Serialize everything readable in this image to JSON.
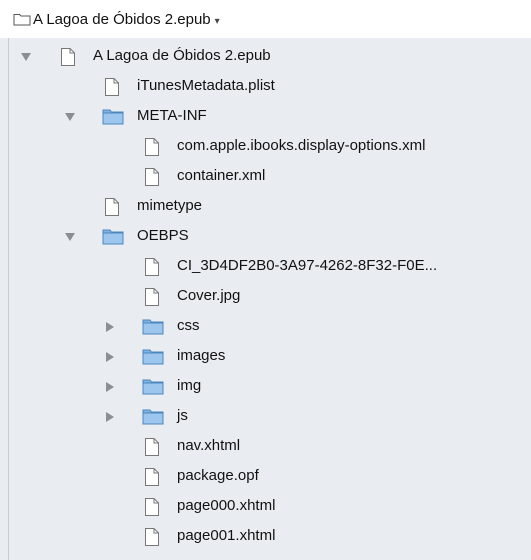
{
  "header": {
    "title": "A Lagoa de Óbidos 2.epub",
    "caret": "▾",
    "icon": "folder-outline-icon"
  },
  "tree": {
    "items": [
      {
        "label": "A Lagoa de Óbidos 2.epub",
        "type": "file",
        "level": 0,
        "disclosure": "expanded"
      },
      {
        "label": "iTunesMetadata.plist",
        "type": "file",
        "level": 1,
        "disclosure": "none"
      },
      {
        "label": "META-INF",
        "type": "folder",
        "level": 1,
        "disclosure": "expanded"
      },
      {
        "label": "com.apple.ibooks.display-options.xml",
        "type": "file",
        "level": 2,
        "disclosure": "none"
      },
      {
        "label": "container.xml",
        "type": "file",
        "level": 2,
        "disclosure": "none"
      },
      {
        "label": "mimetype",
        "type": "file",
        "level": 1,
        "disclosure": "none"
      },
      {
        "label": "OEBPS",
        "type": "folder",
        "level": 1,
        "disclosure": "expanded"
      },
      {
        "label": "CI_3D4DF2B0-3A97-4262-8F32-F0E...",
        "type": "file",
        "level": 2,
        "disclosure": "none"
      },
      {
        "label": "Cover.jpg",
        "type": "file",
        "level": 2,
        "disclosure": "none"
      },
      {
        "label": "css",
        "type": "folder",
        "level": 2,
        "disclosure": "collapsed"
      },
      {
        "label": "images",
        "type": "folder",
        "level": 2,
        "disclosure": "collapsed"
      },
      {
        "label": "img",
        "type": "folder",
        "level": 2,
        "disclosure": "collapsed"
      },
      {
        "label": "js",
        "type": "folder",
        "level": 2,
        "disclosure": "collapsed"
      },
      {
        "label": "nav.xhtml",
        "type": "file",
        "level": 2,
        "disclosure": "none"
      },
      {
        "label": "package.opf",
        "type": "file",
        "level": 2,
        "disclosure": "none"
      },
      {
        "label": "page000.xhtml",
        "type": "file",
        "level": 2,
        "disclosure": "none"
      },
      {
        "label": "page001.xhtml",
        "type": "file",
        "level": 2,
        "disclosure": "none"
      }
    ]
  },
  "colors": {
    "tree_background": "#e9edf2",
    "folder_fill": "#7fb3e3",
    "disclosure": "#8a8f96"
  }
}
